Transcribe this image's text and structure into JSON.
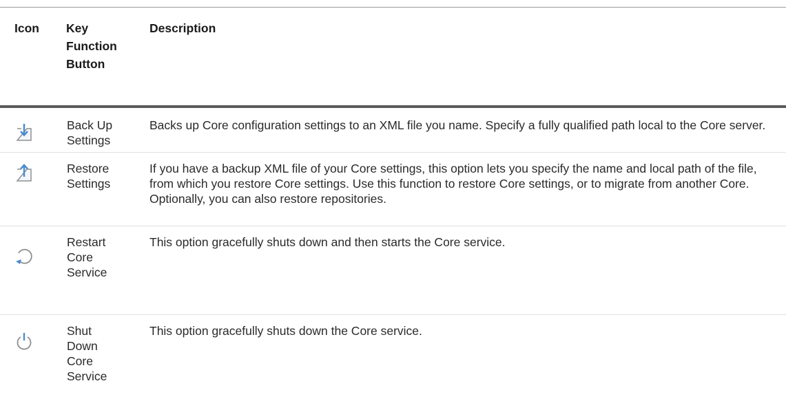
{
  "table": {
    "headers": {
      "icon": "Icon",
      "key": "Key Function Button",
      "description": "Description"
    },
    "rows": [
      {
        "icon": "backup-settings-icon",
        "key": "Back Up Settings",
        "description": "Backs up Core configuration settings to an XML file you name. Specify a fully qualified path local to the Core server."
      },
      {
        "icon": "restore-settings-icon",
        "key": "Restore Settings",
        "description": "If you have a backup XML file of your Core settings, this option lets you specify the name and local path of the file, from which you restore Core settings. Use this function to restore Core settings, or to migrate from another Core. Optionally, you can also restore repositories."
      },
      {
        "icon": "restart-icon",
        "key": "Restart Core Service",
        "description": "This option gracefully shuts down and then starts the Core service."
      },
      {
        "icon": "power-icon",
        "key": "Shut Down Core Service",
        "description": "This option gracefully shuts down the Core service."
      }
    ]
  },
  "colors": {
    "icon_blue": "#4a8ccf",
    "icon_gray": "#8f8f8f",
    "text": "#2a2a2a"
  }
}
